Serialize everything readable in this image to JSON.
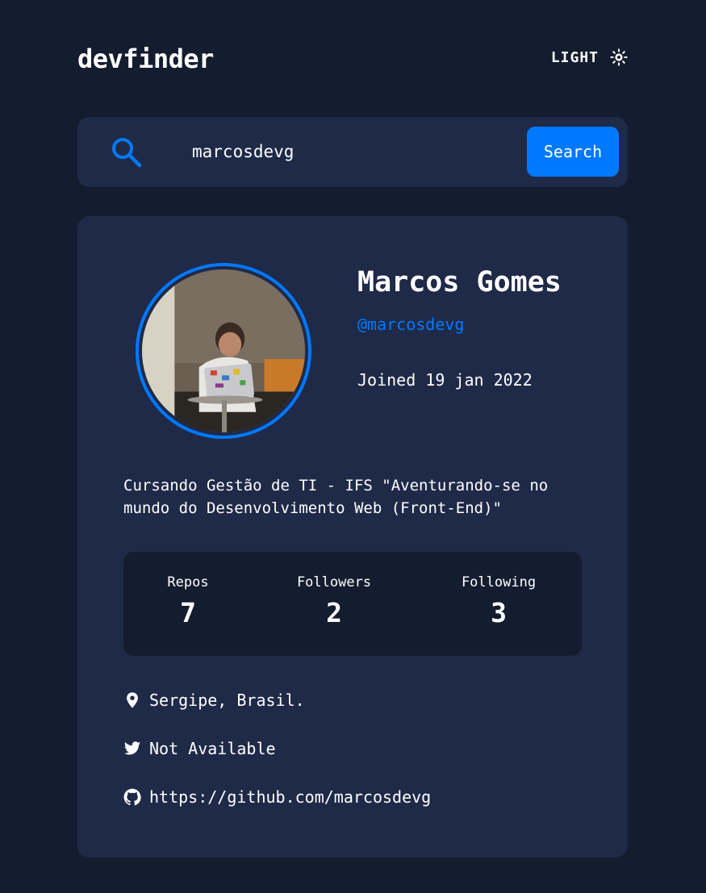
{
  "header": {
    "logo": "devfinder",
    "theme_label": "LIGHT"
  },
  "search": {
    "value": "marcosdevg",
    "button_label": "Search"
  },
  "profile": {
    "name": "Marcos Gomes",
    "handle": "@marcosdevg",
    "joined": "Joined 19 jan 2022",
    "bio": "Cursando Gestão de TI - IFS \"Aventurando-se no mundo do Desenvolvimento Web (Front-End)\""
  },
  "stats": {
    "repos_label": "Repos",
    "repos_value": "7",
    "followers_label": "Followers",
    "followers_value": "2",
    "following_label": "Following",
    "following_value": "3"
  },
  "links": {
    "location": "Sergipe, Brasil.",
    "twitter": "Not Available",
    "github": "https://github.com/marcosdevg"
  },
  "colors": {
    "background": "#141d2f",
    "card": "#1f2a48",
    "accent": "#0079ff",
    "text": "#ffffff"
  },
  "icons": {
    "theme": "sun-icon",
    "search": "search-icon",
    "location": "location-pin-icon",
    "twitter": "twitter-icon",
    "github": "github-icon"
  }
}
